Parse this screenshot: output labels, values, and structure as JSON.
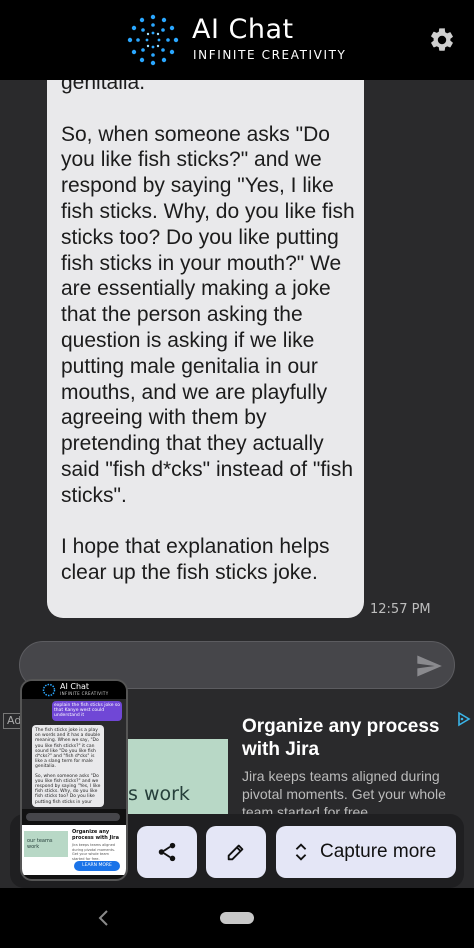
{
  "header": {
    "app_name": "AI Chat",
    "tagline": "INFINITE CREATIVITY",
    "settings_icon": "gear-icon"
  },
  "chat": {
    "bot_message": "genitalia.\n\nSo, when someone asks \"Do you like fish sticks?\" and we respond by saying \"Yes, I like fish sticks. Why, do you like fish sticks too? Do you like putting fish sticks in your mouth?\" We are essentially making a joke that the person asking the question is asking if we like putting male genitalia in our mouths, and we are playfully agreeing with them by pretending that they actually said \"fish d*cks\" instead of \"fish sticks\".\n\nI hope that explanation helps clear up the fish sticks joke.",
    "timestamp": "12:57 PM"
  },
  "input": {
    "value": "",
    "placeholder": "",
    "send_icon": "send-icon"
  },
  "ad": {
    "badge": "Ad",
    "title": "Organize any process with Jira",
    "description": "Jira keeps teams aligned during pivotal moments. Get your whole team started for free.",
    "image_text": "s work"
  },
  "actions": {
    "share_icon": "share-icon",
    "edit_icon": "pencil-icon",
    "capture_label": "Capture more",
    "capture_icon": "expand-vertical-icon"
  },
  "thumbnail": {
    "app_name": "AI Chat",
    "tagline": "INFINITE CREATIVITY",
    "user_message": "explain the fish sticks joke so that Kanye west could understand it",
    "bot_p1": "The fish sticks joke is a play on words and it has a double meaning. When we say, \"Do you like fish sticks?\" it can sound like \"Do you like fish d*cks?\" and \"fish d*cks\" is like a slang term for male genitalia.",
    "bot_p2": "So, when someone asks \"Do you like fish sticks?\" and we respond by saying \"Yes, I like fish sticks. Why, do you like fish sticks too? Do you like putting fish sticks in your",
    "ad_title": "Organize any process with Jira",
    "ad_desc": "Jira keeps teams aligned during pivotal moments. Get your whole team started for free.",
    "ad_img_text": "our teams work",
    "ad_button": "LEARN MORE"
  },
  "navbar": {
    "back_icon": "back-icon",
    "home_icon": "home-pill-icon"
  },
  "colors": {
    "header_bg": "#000000",
    "chat_bg": "#2a2a2c",
    "bubble_bg": "#e9e9eb",
    "button_bg": "#e4e6f6",
    "user_bubble": "#7047d6"
  }
}
